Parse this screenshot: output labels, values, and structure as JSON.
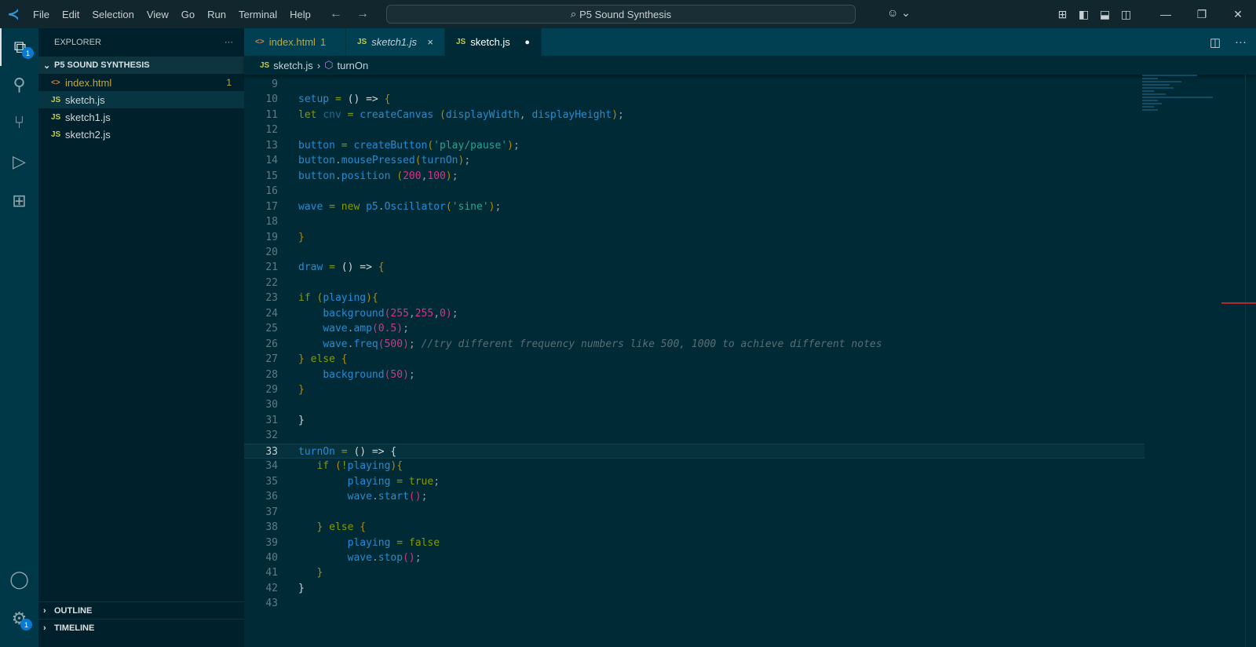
{
  "titlebar": {
    "menu": [
      "File",
      "Edit",
      "Selection",
      "View",
      "Go",
      "Run",
      "Terminal",
      "Help"
    ],
    "search": "P5 Sound Synthesis",
    "back": "←",
    "forward": "→"
  },
  "activity": {
    "explorer_badge": "1",
    "settings_badge": "1"
  },
  "sidebar": {
    "title": "EXPLORER",
    "more": "···",
    "folder": "P5 SOUND SYNTHESIS",
    "files": [
      {
        "name": "index.html",
        "type": "html",
        "problems": "1"
      },
      {
        "name": "sketch.js",
        "type": "js"
      },
      {
        "name": "sketch1.js",
        "type": "js"
      },
      {
        "name": "sketch2.js",
        "type": "js"
      }
    ],
    "outline": "OUTLINE",
    "timeline": "TIMELINE"
  },
  "tabs": [
    {
      "name": "index.html",
      "problems": "1",
      "icon": "<>"
    },
    {
      "name": "sketch1.js",
      "icon": "JS",
      "close": "×"
    },
    {
      "name": "sketch.js",
      "icon": "JS",
      "dirty": "●"
    }
  ],
  "breadcrumb": {
    "file": "sketch.js",
    "symbol": "turnOn",
    "icon": "JS"
  },
  "colors": {
    "editor_bg": "#002b36",
    "keyword": "#859900",
    "identifier": "#268bd2",
    "number": "#d33682",
    "string": "#2aa198",
    "comment": "#586e75"
  },
  "code": {
    "current_line": "33",
    "lines": [
      {
        "num": "9",
        "tokens": []
      },
      {
        "num": "10",
        "tokens": [
          [
            "i",
            "setup"
          ],
          [
            "o",
            " = "
          ],
          [
            "w",
            "() => "
          ],
          [
            "b",
            "{"
          ]
        ]
      },
      {
        "num": "11",
        "tokens": [
          [
            "k",
            "let "
          ],
          [
            "v",
            "cnv"
          ],
          [
            "o",
            " = "
          ],
          [
            "i",
            "createCanvas "
          ],
          [
            "b",
            "("
          ],
          [
            "i",
            "displayWidth"
          ],
          [
            "p",
            ", "
          ],
          [
            "i",
            "displayHeight"
          ],
          [
            "b",
            ")"
          ],
          [
            "p",
            ";"
          ]
        ]
      },
      {
        "num": "12",
        "tokens": []
      },
      {
        "num": "13",
        "tokens": [
          [
            "i",
            "button"
          ],
          [
            "o",
            " = "
          ],
          [
            "i",
            "createButton"
          ],
          [
            "b",
            "("
          ],
          [
            "s",
            "'play/pause'"
          ],
          [
            "b",
            ")"
          ],
          [
            "p",
            ";"
          ]
        ]
      },
      {
        "num": "14",
        "tokens": [
          [
            "i",
            "button"
          ],
          [
            "p",
            "."
          ],
          [
            "i",
            "mousePressed"
          ],
          [
            "b",
            "("
          ],
          [
            "i",
            "turnOn"
          ],
          [
            "b",
            ")"
          ],
          [
            "p",
            ";"
          ]
        ]
      },
      {
        "num": "15",
        "tokens": [
          [
            "i",
            "button"
          ],
          [
            "p",
            "."
          ],
          [
            "i",
            "position "
          ],
          [
            "b",
            "("
          ],
          [
            "n",
            "200"
          ],
          [
            "p",
            ","
          ],
          [
            "n",
            "100"
          ],
          [
            "b",
            ")"
          ],
          [
            "p",
            ";"
          ]
        ]
      },
      {
        "num": "16",
        "tokens": []
      },
      {
        "num": "17",
        "tokens": [
          [
            "i",
            "wave"
          ],
          [
            "o",
            " = "
          ],
          [
            "k",
            "new "
          ],
          [
            "i",
            "p5"
          ],
          [
            "p",
            "."
          ],
          [
            "i",
            "Oscillator"
          ],
          [
            "b",
            "("
          ],
          [
            "s",
            "'sine'"
          ],
          [
            "b",
            ")"
          ],
          [
            "p",
            ";"
          ]
        ]
      },
      {
        "num": "18",
        "tokens": []
      },
      {
        "num": "19",
        "tokens": [
          [
            "b",
            "}"
          ]
        ]
      },
      {
        "num": "20",
        "tokens": []
      },
      {
        "num": "21",
        "tokens": [
          [
            "i",
            "draw"
          ],
          [
            "o",
            " = "
          ],
          [
            "w",
            "() => "
          ],
          [
            "b",
            "{"
          ]
        ]
      },
      {
        "num": "22",
        "tokens": []
      },
      {
        "num": "23",
        "tokens": [
          [
            "k",
            "if "
          ],
          [
            "b",
            "("
          ],
          [
            "i",
            "playing"
          ],
          [
            "b",
            ")"
          ],
          [
            "b",
            "{"
          ]
        ]
      },
      {
        "num": "24",
        "tokens": [
          [
            "p",
            "    "
          ],
          [
            "i",
            "background"
          ],
          [
            "m",
            "("
          ],
          [
            "n",
            "255"
          ],
          [
            "p",
            ","
          ],
          [
            "n",
            "255"
          ],
          [
            "p",
            ","
          ],
          [
            "n",
            "0"
          ],
          [
            "m",
            ")"
          ],
          [
            "p",
            ";"
          ]
        ]
      },
      {
        "num": "25",
        "tokens": [
          [
            "p",
            "    "
          ],
          [
            "i",
            "wave"
          ],
          [
            "p",
            "."
          ],
          [
            "i",
            "amp"
          ],
          [
            "m",
            "("
          ],
          [
            "n",
            "0.5"
          ],
          [
            "m",
            ")"
          ],
          [
            "p",
            ";"
          ]
        ]
      },
      {
        "num": "26",
        "tokens": [
          [
            "p",
            "    "
          ],
          [
            "i",
            "wave"
          ],
          [
            "p",
            "."
          ],
          [
            "i",
            "freq"
          ],
          [
            "m",
            "("
          ],
          [
            "n",
            "500"
          ],
          [
            "m",
            ")"
          ],
          [
            "p",
            "; "
          ],
          [
            "c",
            "//try different frequency numbers like 500, 1000 to achieve different notes"
          ]
        ]
      },
      {
        "num": "27",
        "tokens": [
          [
            "b",
            "} "
          ],
          [
            "k",
            "else "
          ],
          [
            "b",
            "{"
          ]
        ]
      },
      {
        "num": "28",
        "tokens": [
          [
            "p",
            "    "
          ],
          [
            "i",
            "background"
          ],
          [
            "m",
            "("
          ],
          [
            "n",
            "50"
          ],
          [
            "m",
            ")"
          ],
          [
            "p",
            ";"
          ]
        ]
      },
      {
        "num": "29",
        "tokens": [
          [
            "b",
            "}"
          ]
        ]
      },
      {
        "num": "30",
        "tokens": []
      },
      {
        "num": "31",
        "tokens": [
          [
            "w",
            "}"
          ]
        ]
      },
      {
        "num": "32",
        "tokens": []
      },
      {
        "num": "33",
        "tokens": [
          [
            "i",
            "turnOn"
          ],
          [
            "o",
            " = "
          ],
          [
            "w",
            "() => "
          ],
          [
            "w",
            "{"
          ]
        ]
      },
      {
        "num": "34",
        "tokens": [
          [
            "p",
            "   "
          ],
          [
            "k",
            "if "
          ],
          [
            "b",
            "("
          ],
          [
            "o",
            "!"
          ],
          [
            "i",
            "playing"
          ],
          [
            "b",
            ")"
          ],
          [
            "b",
            "{"
          ]
        ]
      },
      {
        "num": "35",
        "tokens": [
          [
            "p",
            "        "
          ],
          [
            "i",
            "playing"
          ],
          [
            "o",
            " = "
          ],
          [
            "k",
            "true"
          ],
          [
            "p",
            ";"
          ]
        ]
      },
      {
        "num": "36",
        "tokens": [
          [
            "p",
            "        "
          ],
          [
            "i",
            "wave"
          ],
          [
            "p",
            "."
          ],
          [
            "i",
            "start"
          ],
          [
            "m",
            "()"
          ],
          [
            "p",
            ";"
          ]
        ]
      },
      {
        "num": "37",
        "tokens": []
      },
      {
        "num": "38",
        "tokens": [
          [
            "p",
            "   "
          ],
          [
            "b",
            "} "
          ],
          [
            "k",
            "else "
          ],
          [
            "b",
            "{"
          ]
        ]
      },
      {
        "num": "39",
        "tokens": [
          [
            "p",
            "        "
          ],
          [
            "i",
            "playing"
          ],
          [
            "o",
            " = "
          ],
          [
            "k",
            "false"
          ]
        ]
      },
      {
        "num": "40",
        "tokens": [
          [
            "p",
            "        "
          ],
          [
            "i",
            "wave"
          ],
          [
            "p",
            "."
          ],
          [
            "i",
            "stop"
          ],
          [
            "m",
            "()"
          ],
          [
            "p",
            ";"
          ]
        ]
      },
      {
        "num": "41",
        "tokens": [
          [
            "p",
            "   "
          ],
          [
            "b",
            "}"
          ]
        ]
      },
      {
        "num": "42",
        "tokens": [
          [
            "w",
            "}"
          ]
        ]
      },
      {
        "num": "43",
        "tokens": []
      }
    ]
  }
}
